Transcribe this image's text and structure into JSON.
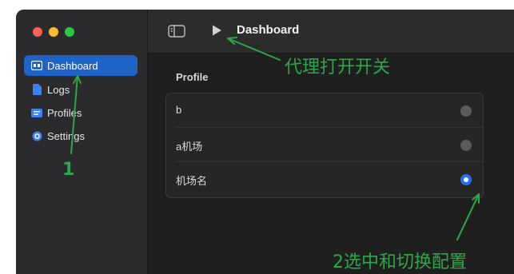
{
  "sidebar": {
    "items": [
      {
        "label": "Dashboard",
        "icon": "dashboard-icon",
        "active": true
      },
      {
        "label": "Logs",
        "icon": "document-icon",
        "active": false
      },
      {
        "label": "Profiles",
        "icon": "profiles-icon",
        "active": false
      },
      {
        "label": "Settings",
        "icon": "gear-icon",
        "active": false
      }
    ]
  },
  "toolbar": {
    "title": "Dashboard",
    "toggle_icon": "sidebar-toggle-icon",
    "play_icon": "play-icon"
  },
  "main": {
    "section_label": "Profile",
    "profiles": [
      {
        "name": "b",
        "selected": false
      },
      {
        "name": "a机场",
        "selected": false
      },
      {
        "name": "机场名",
        "selected": true
      }
    ]
  },
  "annotations": {
    "proxy_toggle": "代理打开开关",
    "step_one": "1",
    "step_two": "2选中和切换配置"
  },
  "colors": {
    "accent": "#1f63c6",
    "radio_selected": "#2a6ef0",
    "annotation": "#2fa64a",
    "traffic_red": "#fe5f57",
    "traffic_yellow": "#febc2e",
    "traffic_green": "#28c840"
  }
}
